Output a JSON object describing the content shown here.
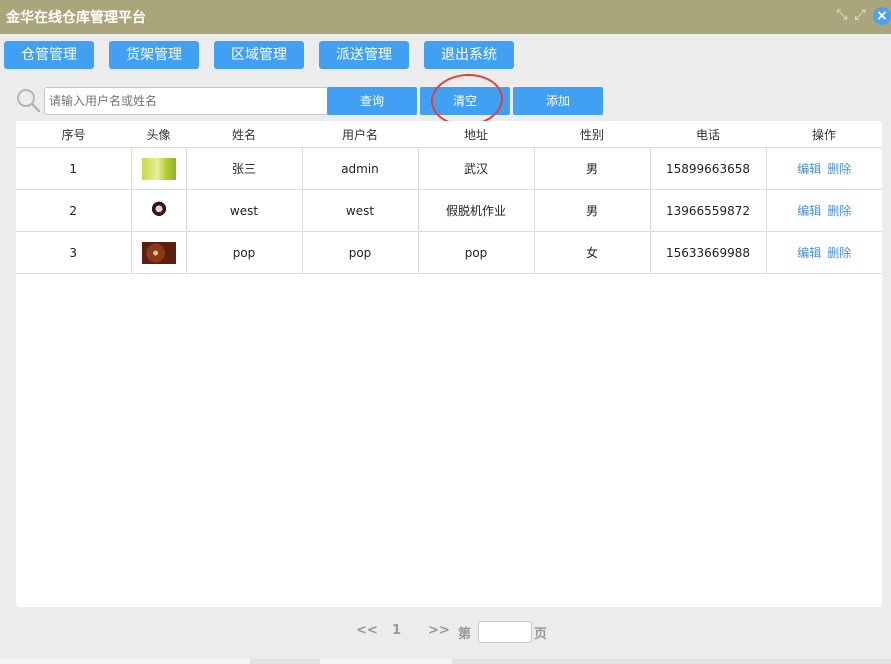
{
  "titlebar": {
    "title": "金华在线仓库管理平台",
    "shrink_icon": "⤡",
    "expand_icon": "⤢",
    "close_icon": "×"
  },
  "nav": [
    "仓管管理",
    "货架管理",
    "区域管理",
    "派送管理",
    "退出系统"
  ],
  "toolbar": {
    "search_placeholder": "请输入用户名或姓名",
    "query_label": "查询",
    "clear_label": "清空",
    "add_label": "添加"
  },
  "table": {
    "headers": [
      "序号",
      "头像",
      "姓名",
      "用户名",
      "地址",
      "性别",
      "电话",
      "操作"
    ],
    "rows": [
      {
        "no": "1",
        "name": "张三",
        "username": "admin",
        "address": "武汉",
        "gender": "男",
        "phone": "15899663658"
      },
      {
        "no": "2",
        "name": "west",
        "username": "west",
        "address": "假脱机作业",
        "gender": "男",
        "phone": "13966559872"
      },
      {
        "no": "3",
        "name": "pop",
        "username": "pop",
        "address": "pop",
        "gender": "女",
        "phone": "15633669988"
      }
    ],
    "edit_label": "编辑",
    "delete_label": "删除"
  },
  "pager": {
    "prev": "<<",
    "page": "1",
    "next": ">>",
    "goto_prefix": "第",
    "goto_suffix": "页"
  },
  "colors": {
    "titlebar": "#a8a67a",
    "accent": "#42a0f2",
    "link": "#4a90d9",
    "highlight_circle": "#e04040"
  }
}
